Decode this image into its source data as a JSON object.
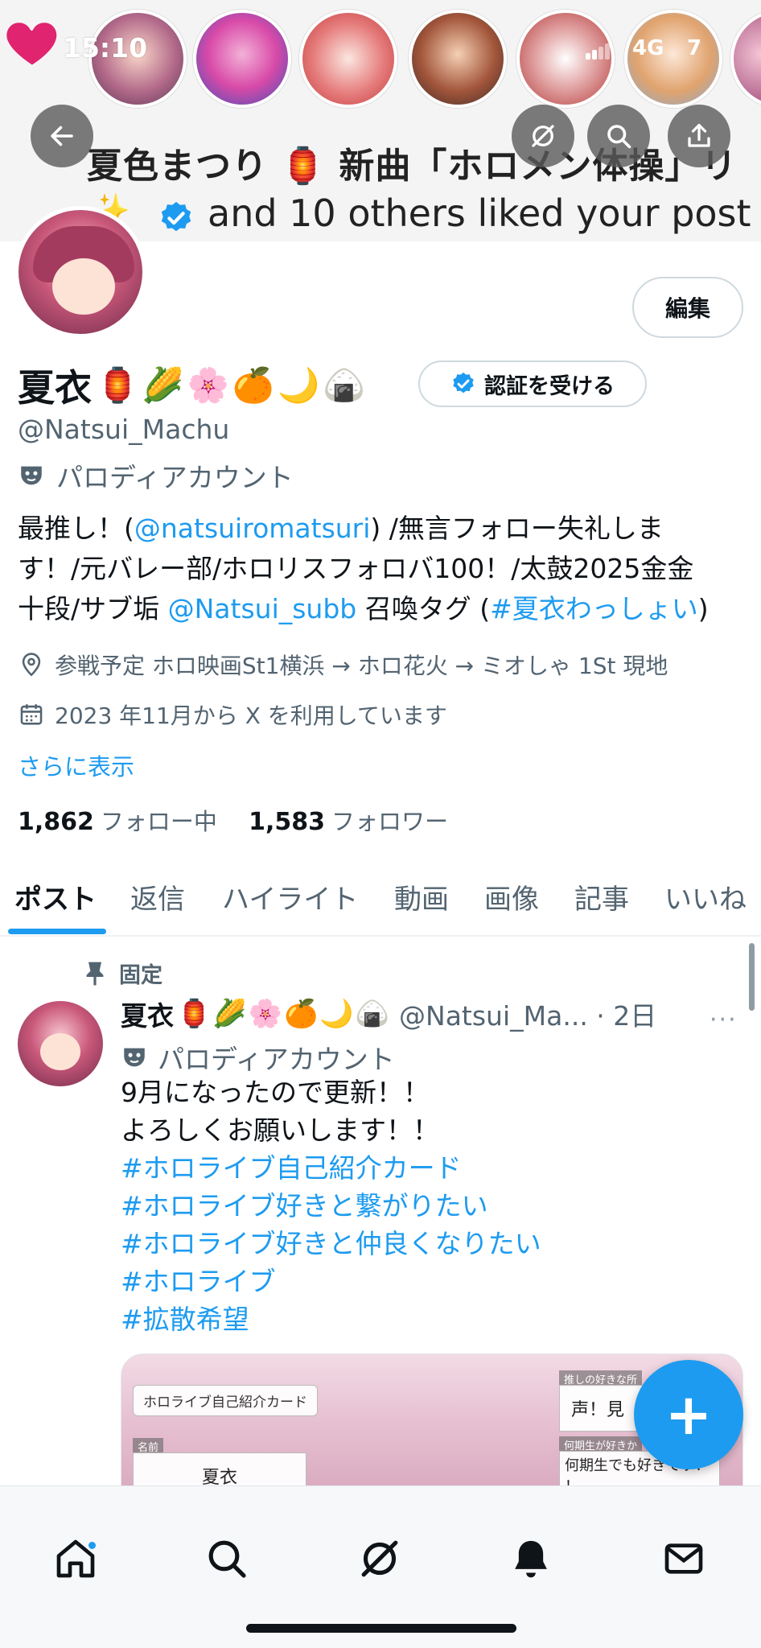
{
  "status_bar": {
    "time": "15:10",
    "network": "4G",
    "battery": "7"
  },
  "banner": {
    "title": "夏色まつり 🏮 新曲「ホロメン体操」リ",
    "liked_text": "and 10 others liked your post",
    "sparkle": "✨"
  },
  "header_actions": {
    "back_icon": "arrow-left-icon",
    "grok_icon": "grok-icon",
    "search_icon": "search-icon",
    "share_icon": "share-icon"
  },
  "profile": {
    "edit_label": "編集",
    "name": "夏衣",
    "name_emoji": "🏮🌽🌸🍊🌙🍙",
    "verify_label": "認証を受ける",
    "handle": "@Natsui_Machu",
    "parody_label": "パロディアカウント",
    "bio_1": "最推し！(",
    "bio_mention": "@natsuiromatsuri",
    "bio_2": ") /無言フォロー失礼しま",
    "bio_3": "す！/元バレー部/ホロリスフォロバ100！/太鼓2025金金",
    "bio_4": "十段/サブ垢 ",
    "bio_mention2": "@Natsui_subb",
    "bio_5": " 召喚タグ (",
    "bio_hashtag": "#夏衣わっしょい",
    "bio_6": ")",
    "location": "参戦予定 ホロ映画St1横浜 → ホロ花火 → ミオしゃ 1St 現地",
    "joined": "2023 年11月から X を利用しています",
    "show_more": "さらに表示",
    "following_count": "1,862",
    "following_label": "フォロー中",
    "followers_count": "1,583",
    "followers_label": "フォロワー"
  },
  "tabs": [
    "ポスト",
    "返信",
    "ハイライト",
    "動画",
    "画像",
    "記事",
    "いいね"
  ],
  "pinned_post": {
    "pinned_label": "固定",
    "name": "夏衣",
    "name_emoji": "🏮🌽🌸🍊🌙🍙",
    "handle_time": "@Natsui_Ma... · 2日",
    "more": "···",
    "parody_label": "パロディアカウント",
    "lines": [
      "9月になったので更新！！",
      "よろしくお願いします！！",
      "#ホロライブ自己紹介カード",
      "#ホロライブ好きと繋がりたい",
      "#ホロライブ好きと仲良くなりたい",
      "#ホロライブ",
      "#拡散希望"
    ],
    "card": {
      "title": "ホロライブ自己紹介カード",
      "name_caption": "名前",
      "name_value": "夏衣",
      "fav_caption": "推しの好きな所",
      "fav_value": "声！見",
      "gen_caption": "何期生が好きか",
      "gen_value": "何期生でも好きです！ ！"
    }
  },
  "fab_label": "+",
  "bottom_nav": [
    "home-icon",
    "search-icon",
    "grok-icon",
    "notifications-icon",
    "messages-icon"
  ],
  "colors": {
    "accent": "#1d9bf0",
    "text": "#0f1419",
    "muted": "#536471"
  }
}
